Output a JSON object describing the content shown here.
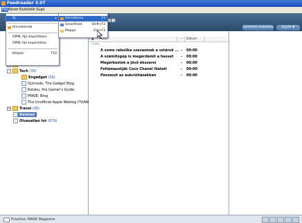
{
  "window": {
    "title": "Feedreader 3.07"
  },
  "menubar": {
    "items": [
      "Fájl",
      "Nézet",
      "Eszközök",
      "Súgó"
    ]
  },
  "header": {
    "title_fragment": "xe",
    "btn_show_all": "Szűrések mutatása",
    "btn_feeds": "Egyéb ▼"
  },
  "file_menu": {
    "new": "Új",
    "subscriptions": "Hírcsatornák",
    "opml_import": "OPML fájl importálása",
    "opml_export": "OPML fájl exportálása",
    "exit": "Kilépés",
    "exit_shortcut": "F10"
  },
  "new_submenu": {
    "feed": "Hírcsatorna",
    "feed_shortcut": "F3",
    "smartfeed": "SmartFeed",
    "smartfeed_shortcut": "Shift+F3",
    "folder": "Mappa",
    "folder_shortcut": "Ctrl+F3"
  },
  "tree": {
    "news": "News",
    "news_count": "(108)",
    "tech": "Tech",
    "tech_count": "(39)",
    "engadget": "Engadget",
    "engadget_count": "(39)",
    "gizmodo": "Gizmodo, The Gadget Blog",
    "kotaku": "Kotaku, the Gamer's Guide",
    "pcworld": "PNKIE: Blog",
    "tuaw": "The Unofficial Apple Weblog (TUAW)",
    "travel": "Travel",
    "travel_count": "(28)",
    "deleted": "Deleted",
    "unread": "Olvasatlan hír",
    "unread_count": "(679)"
  },
  "list": {
    "col_title": "Cím",
    "col_date": "Dátum",
    "group_label": "Ma",
    "rows": [
      {
        "title": "A some rebulika szavazmak a sztárok ...",
        "dash": "-",
        "time": "00:00"
      },
      {
        "title": "A számítógép is megérdemli a hasset",
        "dash": "-",
        "time": "00:00"
      },
      {
        "title": "Megérkeztek a jövő ékszerei",
        "dash": "-",
        "time": "00:00"
      },
      {
        "title": "Feltámasztják Coco Chanel illatait",
        "dash": "-",
        "time": "00:00"
      },
      {
        "title": "Pénzeszt az aukcióházakban",
        "dash": "-",
        "time": "00:00"
      }
    ]
  },
  "status": {
    "text": "Frissítve: MAKE Magazine"
  },
  "colors": {
    "titlebar": "#1a4fc0",
    "header": "#2a4a6a",
    "selection": "#316ac5"
  }
}
